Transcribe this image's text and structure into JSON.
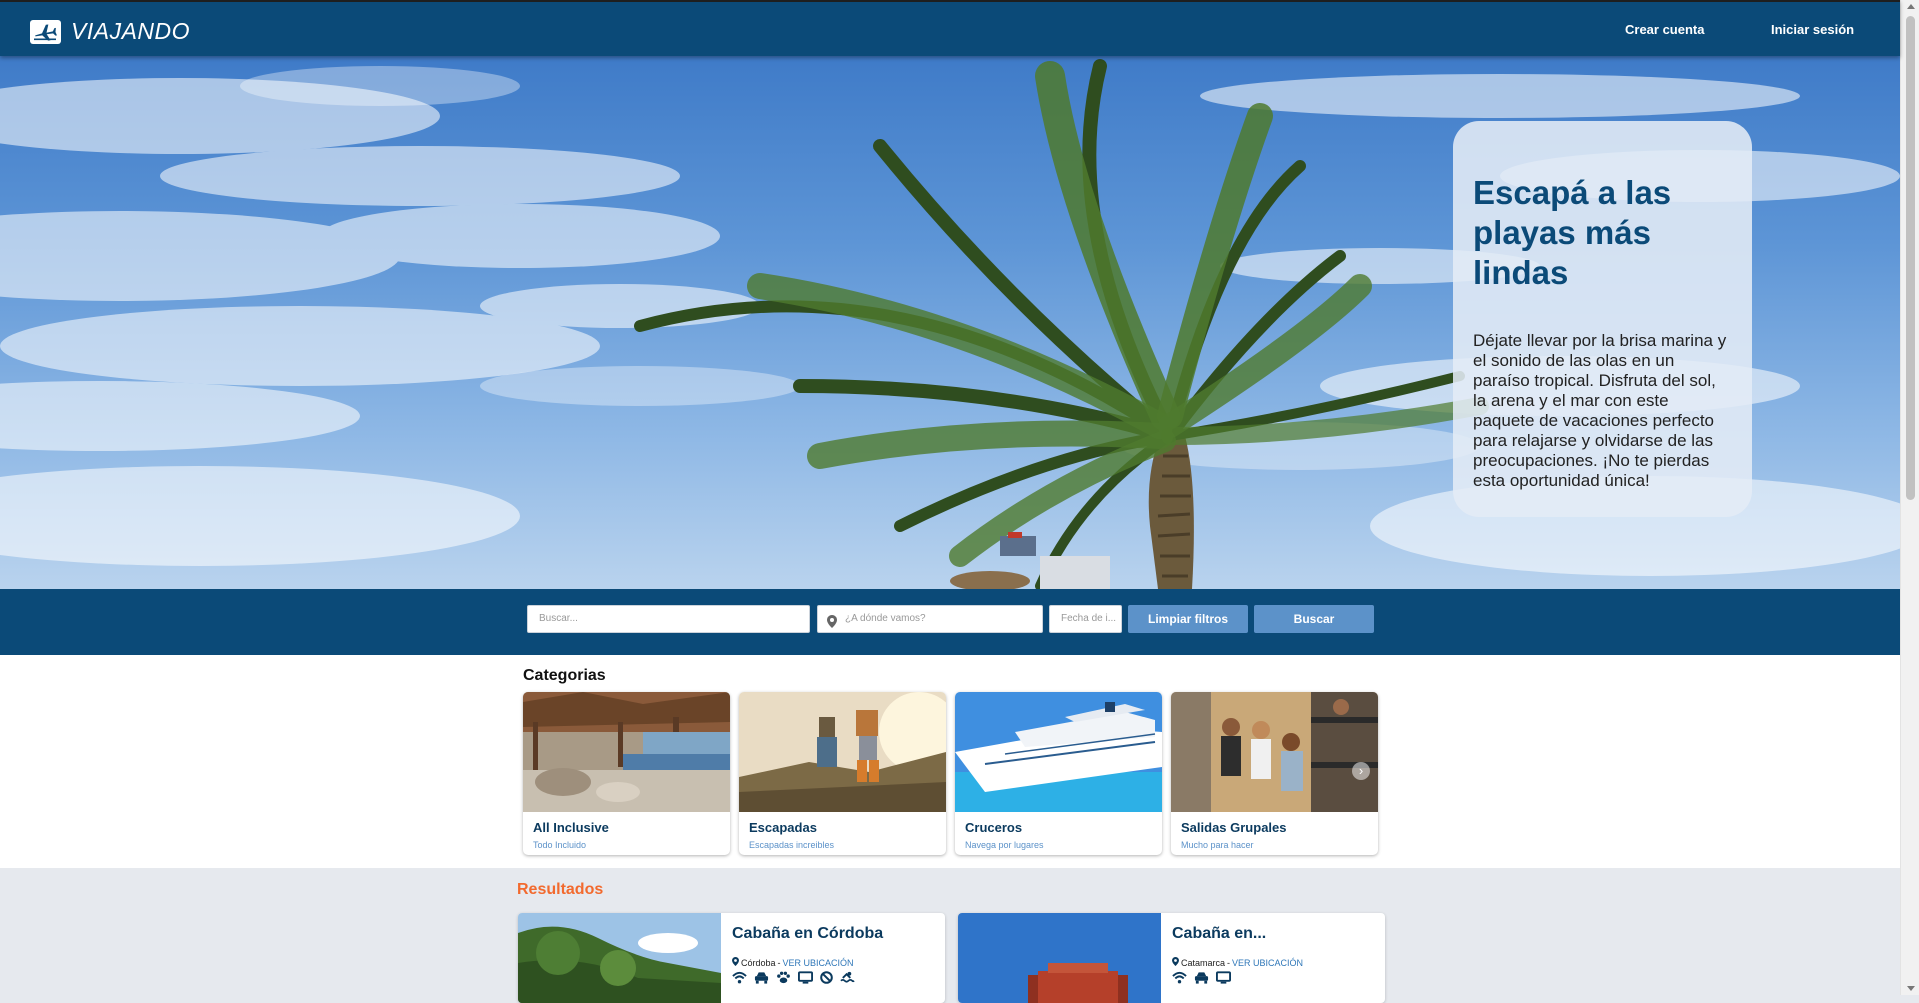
{
  "header": {
    "brand": "VIAJANDO",
    "create_account": "Crear cuenta",
    "login": "Iniciar sesión"
  },
  "hero": {
    "title": "Escapá a las playas más lindas",
    "description": "Déjate llevar por la brisa marina y el sonido de las olas en un paraíso tropical. Disfruta del sol, la arena y el mar con este paquete de vacaciones perfecto para relajarse y olvidarse de las preocupaciones. ¡No te pierdas esta oportunidad única!"
  },
  "search": {
    "query_placeholder": "Buscar...",
    "destination_placeholder": "¿A dónde vamos?",
    "date_placeholder": "Fecha de i...",
    "clear_label": "Limpiar filtros",
    "search_label": "Buscar"
  },
  "categories": {
    "title": "Categorias",
    "items": [
      {
        "name": "All Inclusive",
        "subtitle": "Todo Incluido"
      },
      {
        "name": "Escapadas",
        "subtitle": "Escapadas increibles"
      },
      {
        "name": "Cruceros",
        "subtitle": "Navega por lugares"
      },
      {
        "name": "Salidas Grupales",
        "subtitle": "Mucho para hacer"
      }
    ]
  },
  "results": {
    "title": "Resultados",
    "items": [
      {
        "title": "Cabaña en Córdoba",
        "location": "Córdoba",
        "separator": " - ",
        "map_link": "VER UBICACIÓN",
        "amenities": [
          "wifi-icon",
          "car-icon",
          "pet-icon",
          "tv-icon",
          "no-smoking-icon",
          "pool-icon"
        ]
      },
      {
        "title": "Cabaña en...",
        "location": "Catamarca",
        "separator": " - ",
        "map_link": "VER UBICACIÓN",
        "amenities": [
          "wifi-icon",
          "car-icon",
          "tv-icon"
        ]
      }
    ]
  },
  "colors": {
    "primary": "#0b4a78",
    "button": "#5c92c9",
    "accent": "#f26a2e"
  }
}
